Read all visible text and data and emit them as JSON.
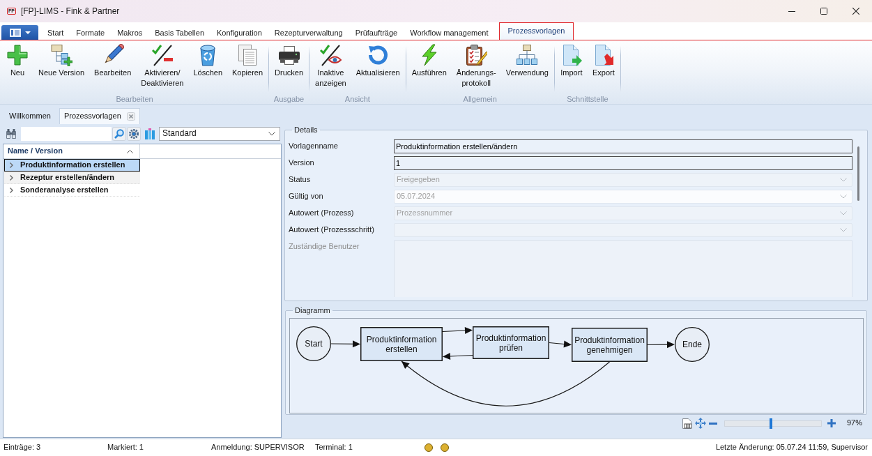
{
  "window": {
    "logo": "FP",
    "title": "[FP]-LIMS - Fink & Partner"
  },
  "ribbon": {
    "tabs": [
      {
        "label": "Start",
        "selected": false
      },
      {
        "label": "Formate",
        "selected": false
      },
      {
        "label": "Makros",
        "selected": false
      },
      {
        "label": "Basis Tabellen",
        "selected": false
      },
      {
        "label": "Konfiguration",
        "selected": false
      },
      {
        "label": "Rezepturverwaltung",
        "selected": false
      },
      {
        "label": "Prüfaufträge",
        "selected": false
      },
      {
        "label": "Workflow management",
        "selected": false
      },
      {
        "label": "Prozessvorlagen",
        "selected": true
      }
    ],
    "groups": [
      {
        "label": "Bearbeiten",
        "buttons": [
          {
            "label": "Neu"
          },
          {
            "label": "Neue Version"
          },
          {
            "label": "Bearbeiten"
          },
          {
            "label": "Aktivieren/\nDeaktivieren"
          },
          {
            "label": "Löschen"
          },
          {
            "label": "Kopieren"
          }
        ]
      },
      {
        "label": "Ausgabe",
        "buttons": [
          {
            "label": "Drucken"
          }
        ]
      },
      {
        "label": "Ansicht",
        "buttons": [
          {
            "label": "Inaktive\nanzeigen"
          },
          {
            "label": "Aktualisieren"
          }
        ]
      },
      {
        "label": "Allgemein",
        "buttons": [
          {
            "label": "Ausführen"
          },
          {
            "label": "Änderungs-\nprotokoll"
          },
          {
            "label": "Verwendung"
          }
        ]
      },
      {
        "label": "Schnittstelle",
        "buttons": [
          {
            "label": "Import"
          },
          {
            "label": "Export"
          }
        ]
      }
    ]
  },
  "document_tabs": [
    {
      "label": "Willkommen",
      "selected": false,
      "closable": false
    },
    {
      "label": "Prozessvorlagen",
      "selected": true,
      "closable": true
    }
  ],
  "list_panel": {
    "view": {
      "value": "Standard"
    },
    "column": "Name / Version",
    "rows": [
      {
        "name": "Produktinformation erstellen",
        "selected": true,
        "expanded": false
      },
      {
        "name": "Rezeptur erstellen/ändern",
        "selected": false,
        "expanded": false
      },
      {
        "name": "Sonderanalyse erstellen",
        "selected": false,
        "expanded": false
      }
    ]
  },
  "details": {
    "title": "Details",
    "fields": [
      {
        "kind": "text",
        "label": "Vorlagenname",
        "value": "Produktinformation erstellen/ändern",
        "disabled": false
      },
      {
        "kind": "text",
        "label": "Version",
        "value": "1",
        "disabled": false
      },
      {
        "kind": "dropdown",
        "label": "Status",
        "value": "Freigegeben",
        "disabled": true
      },
      {
        "kind": "date",
        "label": "Gültig von",
        "value": "05.07.2024",
        "disabled": true
      },
      {
        "kind": "dropdown",
        "label": "Autowert (Prozess)",
        "value": "Prozessnummer",
        "disabled": true
      },
      {
        "kind": "dropdown",
        "label": "Autowert (Prozessschritt)",
        "disabled": true
      },
      {
        "kind": "list",
        "label": "Zuständige Benutzer",
        "disabled": true
      }
    ]
  },
  "diagram": {
    "title": "Diagramm",
    "nodes": [
      {
        "kind": "start",
        "label": "Start"
      },
      {
        "kind": "step",
        "label": "Produktinformation\nerstellen"
      },
      {
        "kind": "step",
        "label": "Produktinformation\nprüfen"
      },
      {
        "kind": "step",
        "label": "Produktinformation\ngenehmigen"
      },
      {
        "kind": "end",
        "label": "Ende"
      }
    ],
    "zoom": {
      "level": 0.48,
      "reading": "97%"
    }
  },
  "status_bar": {
    "items": [
      "Einträge: 3",
      "Markiert: 1",
      "Anmeldung: SUPERVISOR",
      "Terminal: 1"
    ],
    "indicators": [
      {
        "color": "#dcb030"
      },
      {
        "color": "#dcb030"
      }
    ],
    "last_change": "Letzte Änderung: 05.07.24 11:59, Supervisor"
  }
}
